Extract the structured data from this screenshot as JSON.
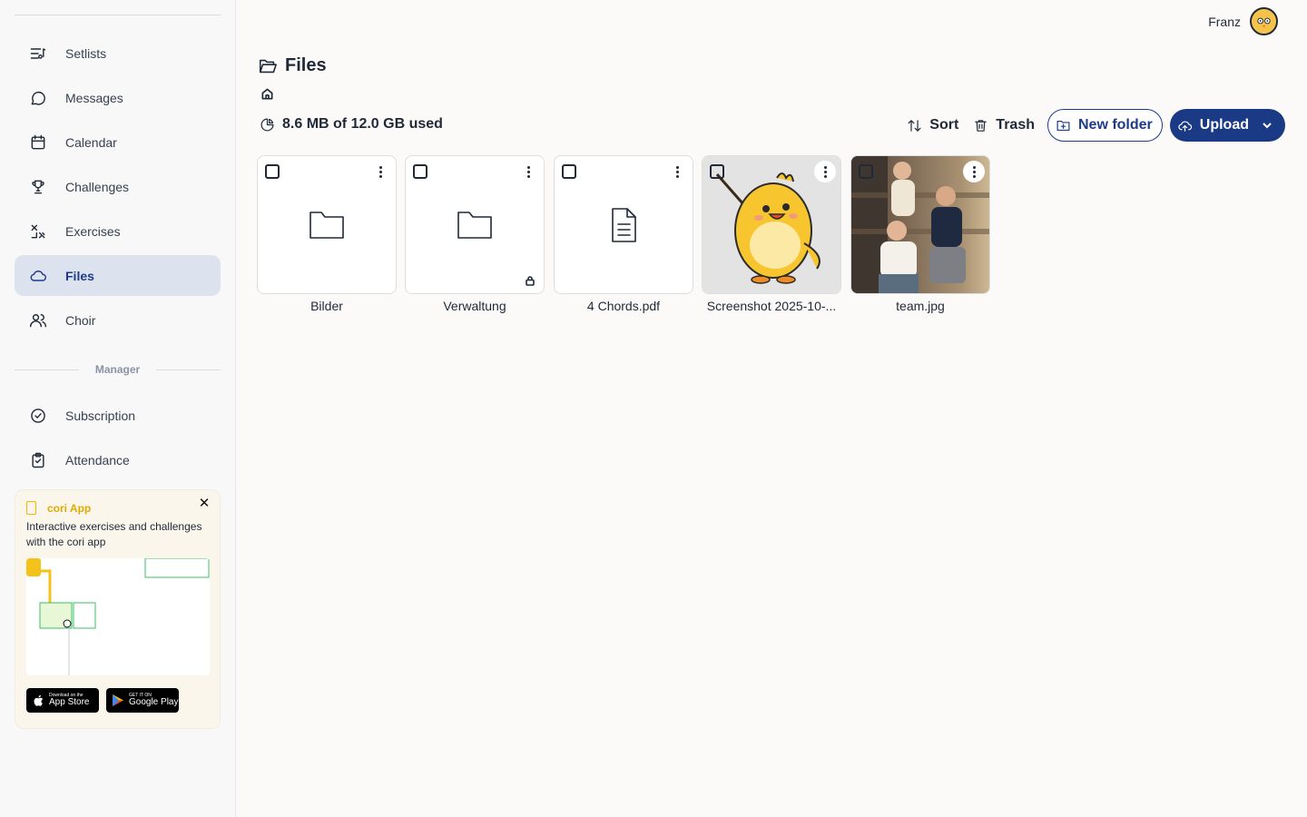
{
  "sidebar": {
    "items": [
      {
        "label": "Setlists",
        "icon": "setlist-icon"
      },
      {
        "label": "Messages",
        "icon": "chat-bubble-icon"
      },
      {
        "label": "Calendar",
        "icon": "calendar-icon"
      },
      {
        "label": "Challenges",
        "icon": "trophy-icon"
      },
      {
        "label": "Exercises",
        "icon": "exercises-icon"
      },
      {
        "label": "Files",
        "icon": "cloud-icon",
        "active": true
      },
      {
        "label": "Choir",
        "icon": "users-icon"
      }
    ],
    "section_label": "Manager",
    "manager_items": [
      {
        "label": "Subscription",
        "icon": "check-circle-icon"
      },
      {
        "label": "Attendance",
        "icon": "clipboard-check-icon"
      }
    ]
  },
  "promo": {
    "title": "cori App",
    "description": "Interactive exercises and challenges with the cori app",
    "app_store_small": "Download on the",
    "app_store_big": "App Store",
    "google_small": "GET IT ON",
    "google_big": "Google Play",
    "accent_color": "#f4b400"
  },
  "header": {
    "user_name": "Franz"
  },
  "page": {
    "title": "Files",
    "usage": "8.6 MB of 12.0 GB used"
  },
  "toolbar": {
    "sort_label": "Sort",
    "trash_label": "Trash",
    "new_folder_label": "New folder",
    "upload_label": "Upload",
    "primary_color": "#1b3a86"
  },
  "files": [
    {
      "name": "Bilder",
      "type": "folder"
    },
    {
      "name": "Verwaltung",
      "type": "folder",
      "locked": true
    },
    {
      "name": "4 Chords.pdf",
      "type": "document"
    },
    {
      "name": "Screenshot 2025-10-...",
      "type": "image"
    },
    {
      "name": "team.jpg",
      "type": "image"
    }
  ]
}
